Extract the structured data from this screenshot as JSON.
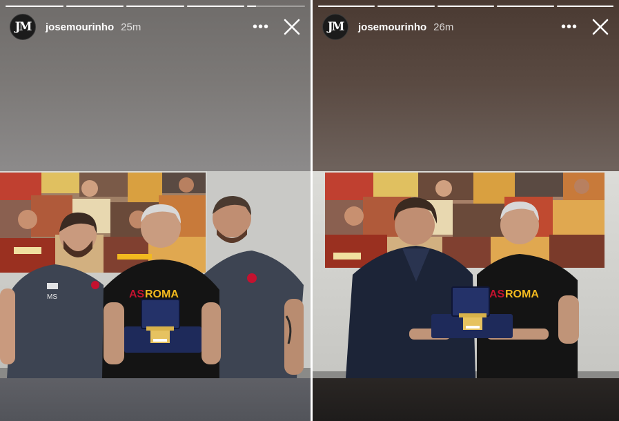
{
  "stories": [
    {
      "username": "josemourinho",
      "time": "25m",
      "avatar_text": "JM",
      "progress": [
        1,
        1,
        1,
        1,
        0.15
      ],
      "photo": {
        "shirt_text": "ASROMA",
        "staff_initials": "MS"
      },
      "icons": {
        "more": "more-options-icon",
        "close": "close-icon"
      }
    },
    {
      "username": "josemourinho",
      "time": "26m",
      "avatar_text": "JM",
      "progress": [
        1,
        1,
        1,
        1,
        1
      ],
      "photo": {
        "shirt_text": "ASROMA"
      },
      "icons": {
        "more": "more-options-icon",
        "close": "close-icon"
      }
    }
  ],
  "colors": {
    "roma_yellow": "#f2b91f",
    "roma_red": "#c4122f",
    "navy_jacket": "#1c2437",
    "grey_shirt": "#3d4452",
    "black_shirt": "#141414",
    "trophy_box": "#1e2a5a",
    "gold": "#d8b24a"
  }
}
